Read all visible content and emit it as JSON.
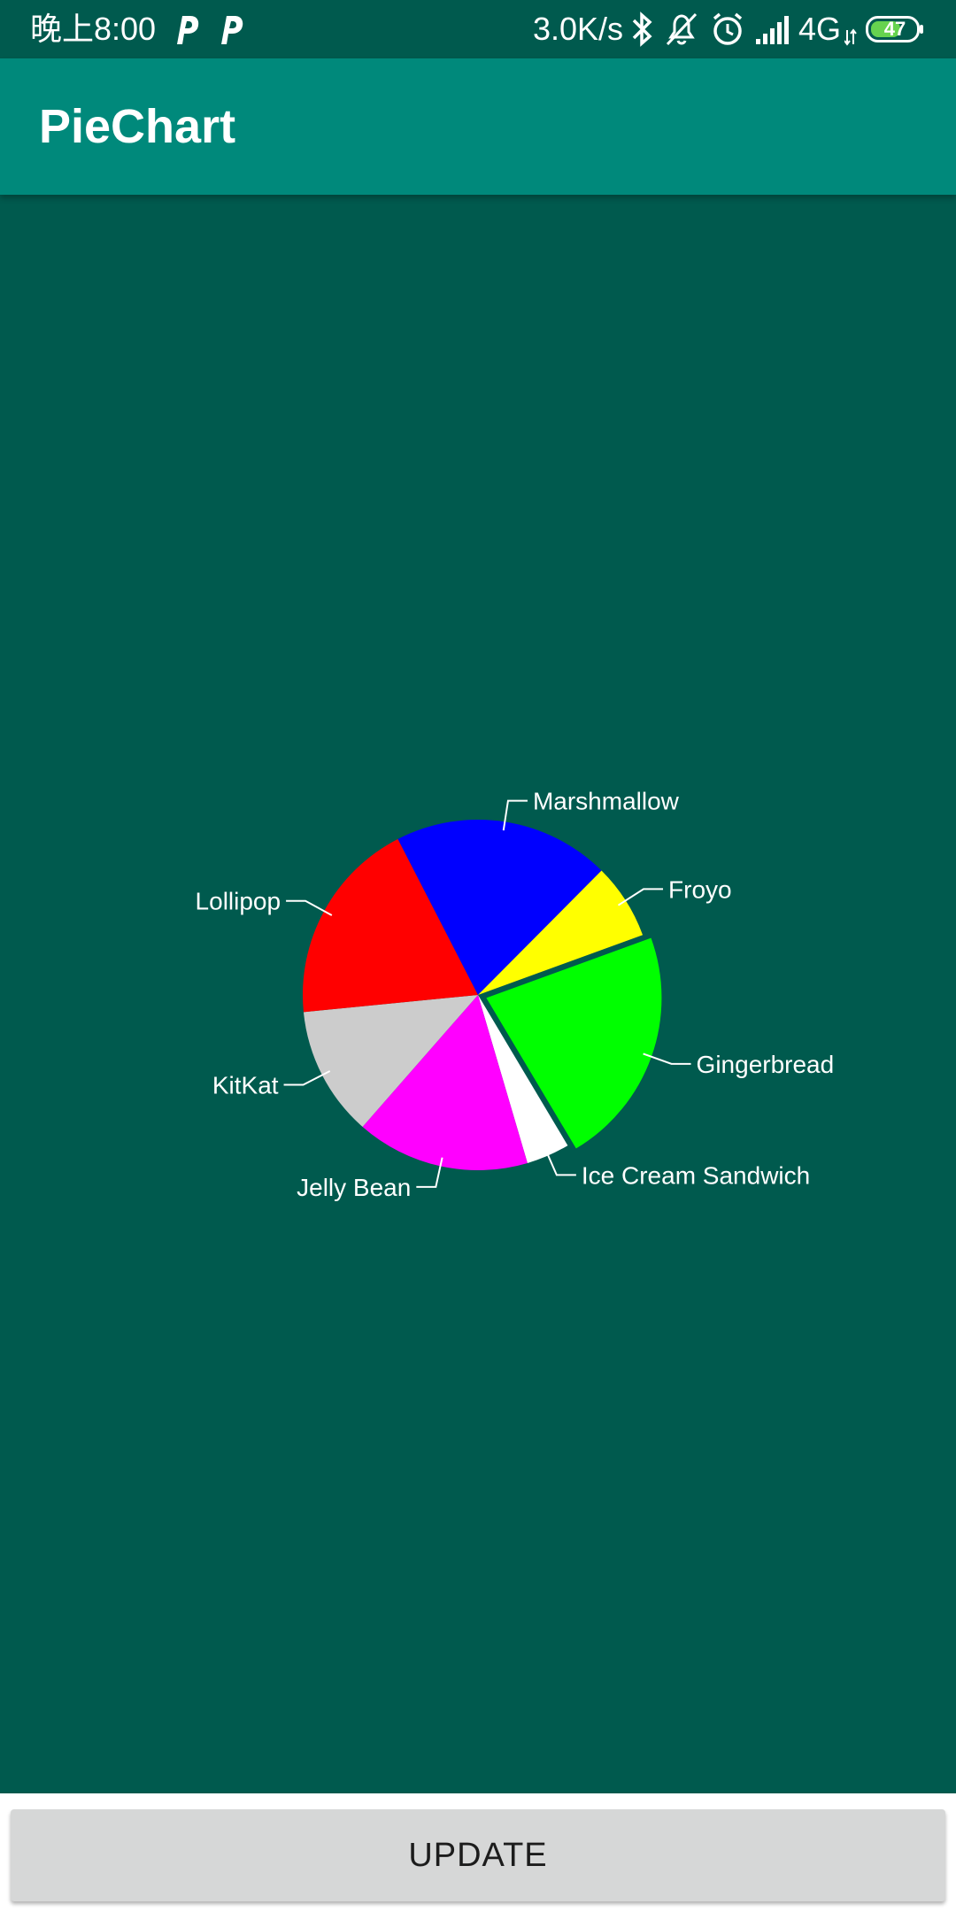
{
  "status_bar": {
    "time": "晚上8:00",
    "network_speed": "3.0K/s",
    "network_type": "4G",
    "battery_level": "47"
  },
  "app_bar": {
    "title": "PieChart"
  },
  "chart_data": {
    "type": "pie",
    "slices": [
      {
        "label": "Gingerbread",
        "value": 22,
        "color": "#00ff00",
        "exploded": true
      },
      {
        "label": "Ice Cream Sandwich",
        "value": 4,
        "color": "#ffffff",
        "exploded": false
      },
      {
        "label": "Jelly Bean",
        "value": 16,
        "color": "#ff00ff",
        "exploded": false
      },
      {
        "label": "KitKat",
        "value": 12,
        "color": "#cccccc",
        "exploded": false
      },
      {
        "label": "Lollipop",
        "value": 19,
        "color": "#ff0000",
        "exploded": false
      },
      {
        "label": "Marshmallow",
        "value": 20,
        "color": "#0000ff",
        "exploded": false
      },
      {
        "label": "Froyo",
        "value": 7,
        "color": "#ffff00",
        "exploded": false
      }
    ],
    "start_angle_degrees": -20,
    "label_color": "#ffffff"
  },
  "colors": {
    "background": "#005a4e",
    "app_bar": "#00897b",
    "button": "#d6d7d7"
  },
  "footer": {
    "update_label": "UPDATE"
  }
}
